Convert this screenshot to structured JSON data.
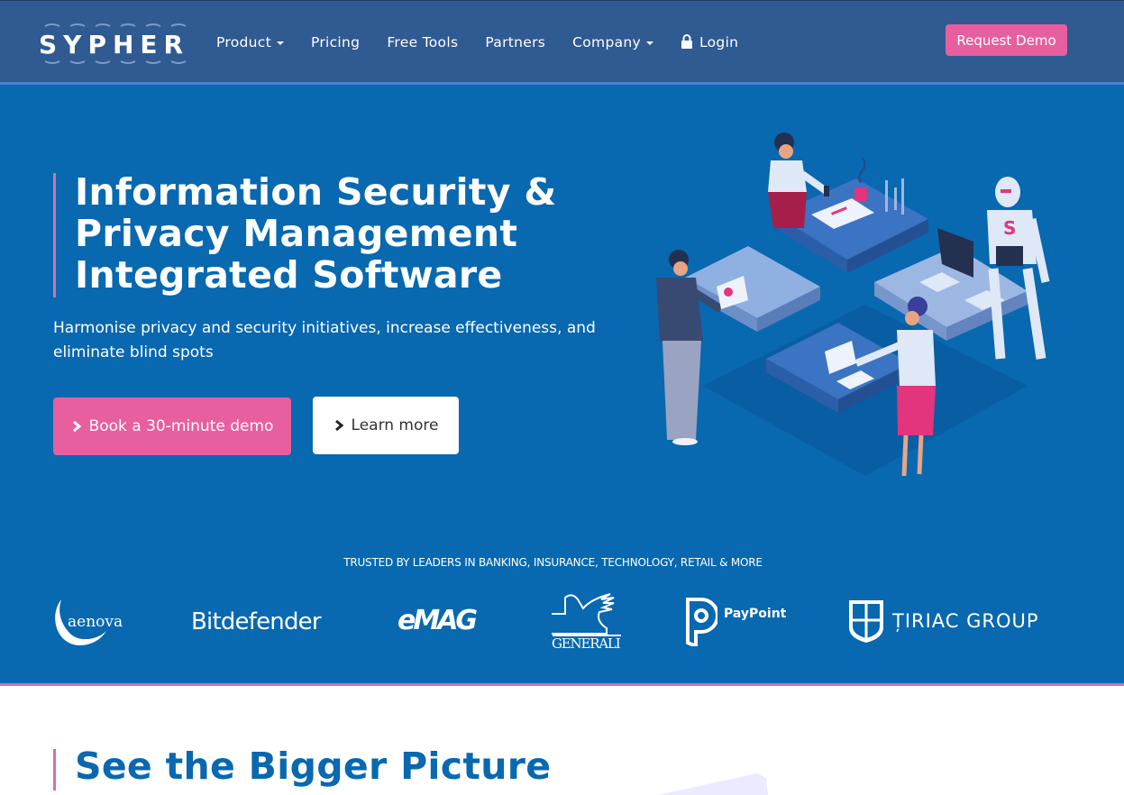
{
  "header": {
    "logo_text": "SYPHER",
    "nav": [
      {
        "label": "Product",
        "has_dropdown": true
      },
      {
        "label": "Pricing",
        "has_dropdown": false
      },
      {
        "label": "Free Tools",
        "has_dropdown": false
      },
      {
        "label": "Partners",
        "has_dropdown": false
      },
      {
        "label": "Company",
        "has_dropdown": true
      },
      {
        "label": "Login",
        "icon": "lock-icon"
      }
    ],
    "cta_label": "Request Demo"
  },
  "hero": {
    "title_lines": [
      "Information Security &",
      "Privacy Management",
      "Integrated Software"
    ],
    "subtitle": "Harmonise privacy and security initiatives, increase effectiveness, and eliminate blind spots",
    "primary_button": {
      "label": "Book a 30-minute demo",
      "icon": "chevron-right-icon"
    },
    "secondary_button": {
      "label": "Learn more",
      "icon": "chevron-right-icon"
    },
    "illustration": "isometric-puzzle-team-with-robot",
    "trusted_text": "TRUSTED BY LEADERS IN BANKING, INSURANCE, TECHNOLOGY, RETAIL & MORE",
    "clients": [
      {
        "name": "aenova"
      },
      {
        "name": "Bitdefender"
      },
      {
        "name": "eMAG"
      },
      {
        "name": "GENERALI"
      },
      {
        "name": "PayPoint"
      },
      {
        "name": "ȚIRIAC GROUP"
      }
    ]
  },
  "section2": {
    "title": "See the Bigger Picture"
  },
  "colors": {
    "header_bg": "#2f5a92",
    "hero_bg": "#0868b0",
    "accent_pink": "#e75f9e",
    "bar_pink": "#d36fab",
    "heading_blue": "#0868b0"
  }
}
